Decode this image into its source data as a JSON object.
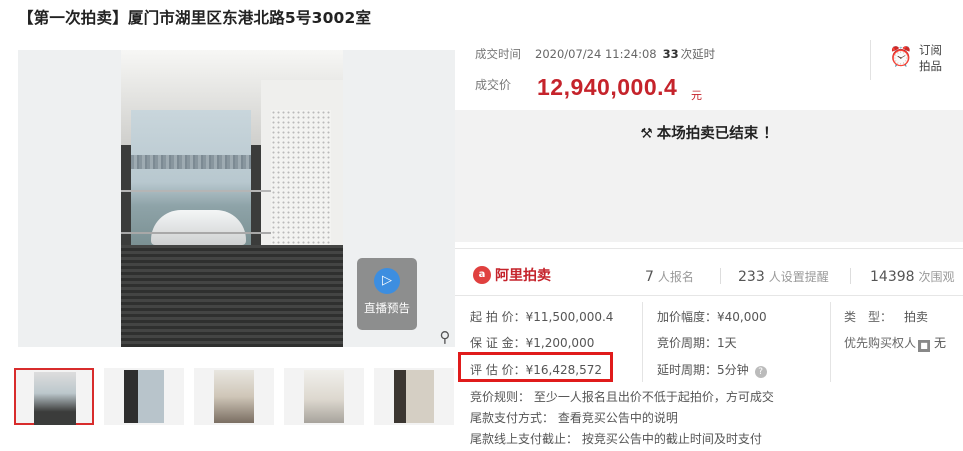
{
  "title": "【第一次拍卖】厦门市湖里区东港北路5号3002室",
  "gallery": {
    "live_label": "直播预告",
    "live_icon": "speaker-icon",
    "zoom_icon": "magnifier-icon",
    "thumbnail_count": 5
  },
  "deal": {
    "time_label": "成交时间",
    "time_value": "2020/07/24 11:24:08",
    "delay_count": "33",
    "delay_unit": "次延时",
    "price_label": "成交价",
    "price_value": "12,940,000.4",
    "price_unit": "元"
  },
  "subscribe": {
    "label": "订阅拍品",
    "icon": "alarm-clock-icon"
  },
  "status": {
    "message": "本场拍卖已结束 ！",
    "icon": "gavel-icon"
  },
  "platform": {
    "logo_text": "阿里拍卖"
  },
  "stats": [
    {
      "num": "7",
      "label": "人报名"
    },
    {
      "num": "233",
      "label": "人设置提醒"
    },
    {
      "num": "14398",
      "label": "次围观"
    }
  ],
  "info": {
    "start_price": "起 拍 价：¥11,500,000.4",
    "deposit": "保 证 金：¥1,200,000",
    "appraisal": "评 估 价：¥16,428,572",
    "increment": "加价幅度：¥40,000",
    "bid_period": "竞价周期：1天",
    "delay_period": "延时周期：5分钟",
    "type_label": "类　型：",
    "type_value": "拍卖",
    "priority_label": "优先购买权人",
    "priority_value": "无"
  },
  "rules": {
    "bid_rule": "竞价规则： 至少一人报名且出价不低于起拍价，方可成交",
    "final_payment": "尾款支付方式： 查看竞买公告中的说明",
    "deadline": "尾款线上支付截止： 按竞买公告中的截止时间及时支付"
  },
  "colors": {
    "accent_red": "#c5232b",
    "highlight_border": "#e01b1b"
  }
}
